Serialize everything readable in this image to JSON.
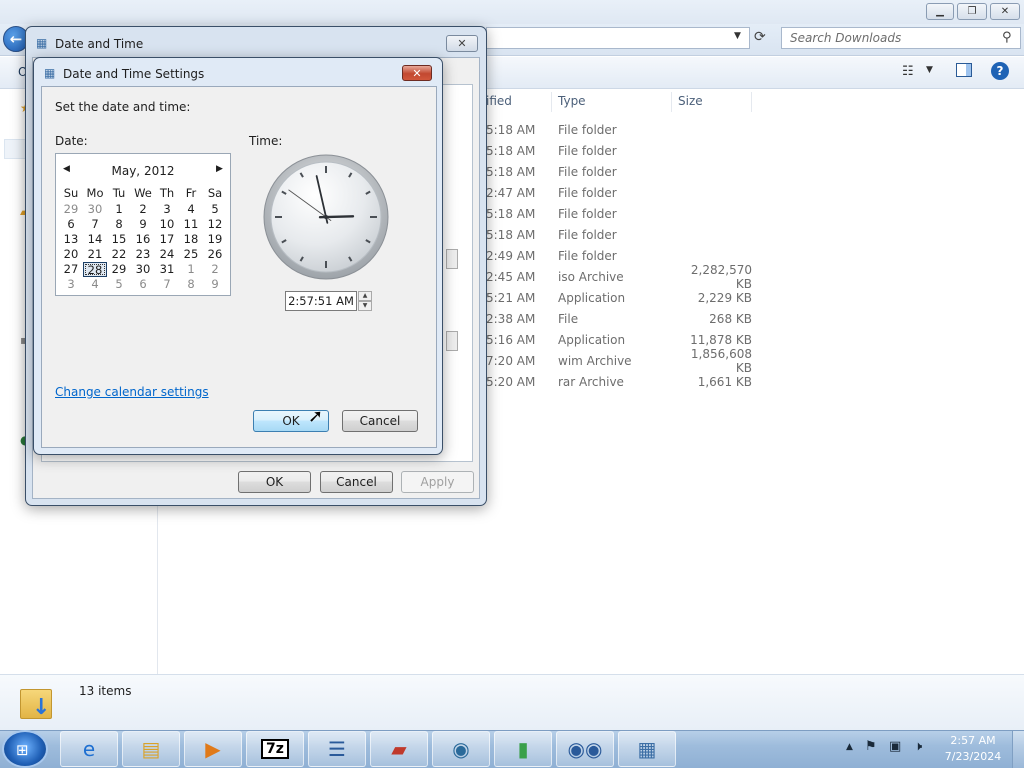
{
  "explorer": {
    "search_placeholder": "Search Downloads",
    "columns": {
      "modified": "ified",
      "type": "Type",
      "size": "Size"
    },
    "rows": [
      {
        "modified": "5:18 AM",
        "type": "File folder",
        "size": ""
      },
      {
        "modified": "5:18 AM",
        "type": "File folder",
        "size": ""
      },
      {
        "modified": "5:18 AM",
        "type": "File folder",
        "size": ""
      },
      {
        "modified": "2:47 AM",
        "type": "File folder",
        "size": ""
      },
      {
        "modified": "5:18 AM",
        "type": "File folder",
        "size": ""
      },
      {
        "modified": "5:18 AM",
        "type": "File folder",
        "size": ""
      },
      {
        "modified": "2:49 AM",
        "type": "File folder",
        "size": ""
      },
      {
        "modified": "2:45 AM",
        "type": "iso Archive",
        "size": "2,282,570 KB"
      },
      {
        "modified": "5:21 AM",
        "type": "Application",
        "size": "2,229 KB"
      },
      {
        "modified": "2:38 AM",
        "type": "File",
        "size": "268 KB"
      },
      {
        "modified": "5:16 AM",
        "type": "Application",
        "size": "11,878 KB"
      },
      {
        "modified": "7:20 AM",
        "type": "wim Archive",
        "size": "1,856,608 KB"
      },
      {
        "modified": "5:20 AM",
        "type": "rar Archive",
        "size": "1,661 KB"
      }
    ],
    "item_count": "13 items",
    "partial_text": {
      "left_c": "O",
      "left_ne": "ne"
    }
  },
  "outer_dialog": {
    "title": "Date and Time",
    "ok": "OK",
    "cancel": "Cancel",
    "apply": "Apply"
  },
  "dialog": {
    "title": "Date and Time Settings",
    "instruction": "Set the date and time:",
    "date_label": "Date:",
    "time_label": "Time:",
    "calendar": {
      "month_year": "May, 2012",
      "weekdays": [
        "Su",
        "Mo",
        "Tu",
        "We",
        "Th",
        "Fr",
        "Sa"
      ],
      "days": [
        {
          "d": "29",
          "dim": true
        },
        {
          "d": "30",
          "dim": true
        },
        {
          "d": "1"
        },
        {
          "d": "2"
        },
        {
          "d": "3"
        },
        {
          "d": "4"
        },
        {
          "d": "5"
        },
        {
          "d": "6"
        },
        {
          "d": "7"
        },
        {
          "d": "8"
        },
        {
          "d": "9"
        },
        {
          "d": "10"
        },
        {
          "d": "11"
        },
        {
          "d": "12"
        },
        {
          "d": "13"
        },
        {
          "d": "14"
        },
        {
          "d": "15"
        },
        {
          "d": "16"
        },
        {
          "d": "17"
        },
        {
          "d": "18"
        },
        {
          "d": "19"
        },
        {
          "d": "20"
        },
        {
          "d": "21"
        },
        {
          "d": "22"
        },
        {
          "d": "23"
        },
        {
          "d": "24"
        },
        {
          "d": "25"
        },
        {
          "d": "26"
        },
        {
          "d": "27"
        },
        {
          "d": "28",
          "sel": true
        },
        {
          "d": "29"
        },
        {
          "d": "30"
        },
        {
          "d": "31"
        },
        {
          "d": "1",
          "dim": true
        },
        {
          "d": "2",
          "dim": true
        },
        {
          "d": "3",
          "dim": true
        },
        {
          "d": "4",
          "dim": true
        },
        {
          "d": "5",
          "dim": true
        },
        {
          "d": "6",
          "dim": true
        },
        {
          "d": "7",
          "dim": true
        },
        {
          "d": "8",
          "dim": true
        },
        {
          "d": "9",
          "dim": true
        }
      ]
    },
    "time_value": "2:57:51 AM",
    "clock": {
      "hour": 2,
      "minute": 57,
      "second": 51
    },
    "link": "Change calendar settings",
    "ok": "OK",
    "cancel": "Cancel"
  },
  "taskbar": {
    "apps": [
      "internet-explorer",
      "windows-explorer",
      "media-player",
      "7zip",
      "task-list",
      "toolbox",
      "network-globe",
      "green-app",
      "eyes-app",
      "date-time-app"
    ],
    "clock_time": "2:57 AM",
    "clock_date": "7/23/2024"
  }
}
